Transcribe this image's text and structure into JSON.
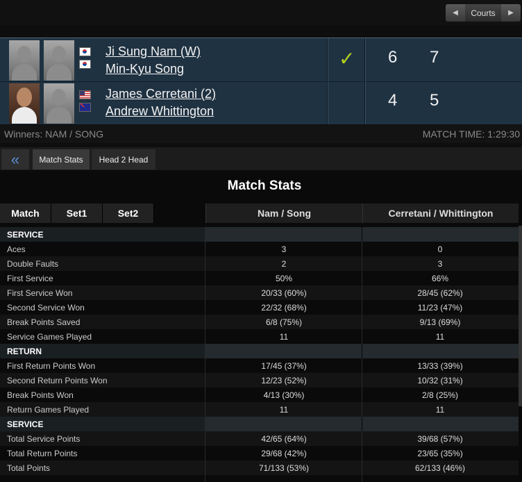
{
  "courts": {
    "label": "Courts",
    "prev_icon": "◀",
    "next_icon": "▶"
  },
  "teams": [
    {
      "player1": "Ji Sung Nam (W)",
      "player2": "Min-Kyu Song",
      "flag1": "KOR",
      "flag2": "KOR",
      "winner_mark": "✓",
      "set1": "6",
      "set2": "7"
    },
    {
      "player1": "James Cerretani (2)",
      "player2": "Andrew Whittington",
      "flag1": "USA",
      "flag2": "AUS",
      "winner_mark": "",
      "set1": "4",
      "set2": "5"
    }
  ],
  "info": {
    "winners": "Winners: NAM / SONG",
    "match_time": "MATCH TIME: 1:29:30"
  },
  "tabs": {
    "back": "«",
    "match_stats": "Match Stats",
    "head2head": "Head 2 Head"
  },
  "panel": {
    "title": "Match Stats",
    "subtabs": [
      "Match",
      "Set1",
      "Set2"
    ],
    "col1": "Nam / Song",
    "col2": "Cerretani / Whittington",
    "rows": [
      {
        "label": "SERVICE",
        "v1": "",
        "v2": ""
      },
      {
        "label": "Aces",
        "v1": "3",
        "v2": "0"
      },
      {
        "label": "Double Faults",
        "v1": "2",
        "v2": "3"
      },
      {
        "label": "First Service",
        "v1": "50%",
        "v2": "66%"
      },
      {
        "label": "First Service Won",
        "v1": "20/33 (60%)",
        "v2": "28/45 (62%)"
      },
      {
        "label": "Second Service Won",
        "v1": "22/32 (68%)",
        "v2": "11/23 (47%)"
      },
      {
        "label": "Break Points Saved",
        "v1": "6/8 (75%)",
        "v2": "9/13 (69%)"
      },
      {
        "label": "Service Games Played",
        "v1": "11",
        "v2": "11"
      },
      {
        "label": "RETURN",
        "v1": "",
        "v2": ""
      },
      {
        "label": "First Return Points Won",
        "v1": "17/45 (37%)",
        "v2": "13/33 (39%)"
      },
      {
        "label": "Second Return Points Won",
        "v1": "12/23 (52%)",
        "v2": "10/32 (31%)"
      },
      {
        "label": "Break Points Won",
        "v1": "4/13 (30%)",
        "v2": "2/8 (25%)"
      },
      {
        "label": "Return Games Played",
        "v1": "11",
        "v2": "11"
      },
      {
        "label": "SERVICE",
        "v1": "",
        "v2": ""
      },
      {
        "label": "Total Service Points",
        "v1": "42/65 (64%)",
        "v2": "39/68 (57%)"
      },
      {
        "label": "Total Return Points",
        "v1": "29/68 (42%)",
        "v2": "23/65 (35%)"
      },
      {
        "label": "Total Points",
        "v1": "71/133 (53%)",
        "v2": "62/133 (46%)"
      }
    ]
  }
}
